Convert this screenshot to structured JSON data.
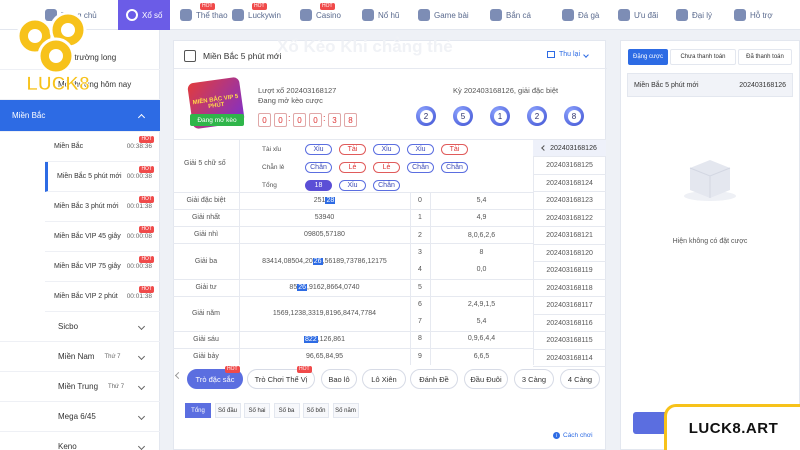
{
  "nav": {
    "items": [
      {
        "label": "Trang chủ",
        "icon": "home-icon",
        "hot": false
      },
      {
        "label": "Xổ số",
        "icon": "lottery-icon",
        "hot": false,
        "active": true
      },
      {
        "label": "Thể thao",
        "icon": "sports-icon",
        "hot": true
      },
      {
        "label": "Luckywin",
        "icon": "luckywin-icon",
        "hot": true
      },
      {
        "label": "Casino",
        "icon": "casino-icon",
        "hot": true
      },
      {
        "label": "Nổ hũ",
        "icon": "slot-icon",
        "hot": false
      },
      {
        "label": "Game bài",
        "icon": "cards-icon",
        "hot": false
      },
      {
        "label": "Bắn cá",
        "icon": "fish-icon",
        "hot": false
      },
      {
        "label": "Đá gà",
        "icon": "rooster-icon",
        "hot": false
      },
      {
        "label": "Ưu đãi",
        "icon": "gift-icon",
        "hot": false
      },
      {
        "label": "Đại lý",
        "icon": "agent-icon",
        "hot": false
      },
      {
        "label": "Hỗ trợ",
        "icon": "support-icon",
        "hot": false
      }
    ],
    "hot_label": "HOT"
  },
  "logo": {
    "text": "LUCK8"
  },
  "sidebar": {
    "top_items": [
      "Các trường long",
      "Mở thưởng hôm nay"
    ],
    "region": "Miền Bắc",
    "sub_items": [
      {
        "label": "Miền Bắc",
        "time": "00:38:36"
      },
      {
        "label": "Miền Bắc 5 phút mới",
        "time": "00:00:38"
      },
      {
        "label": "Miền Bắc 3 phút mới",
        "time": "00:01:38"
      },
      {
        "label": "Miền Bắc VIP 45 giây",
        "time": "00:00:08"
      },
      {
        "label": "Miền Bắc VIP 75 giây",
        "time": "00:00:38"
      },
      {
        "label": "Miền Bắc VIP 2 phút",
        "time": "00:01:38"
      }
    ],
    "groups": [
      {
        "label": "Sicbo",
        "extra": ""
      },
      {
        "label": "Miền Nam",
        "extra": "Thứ 7"
      },
      {
        "label": "Miền Trung",
        "extra": "Thứ 7"
      },
      {
        "label": "Mega 6/45",
        "extra": ""
      },
      {
        "label": "Keno",
        "extra": ""
      }
    ]
  },
  "game": {
    "title": "Miền Bắc 5 phút mới",
    "watermark": "Xổ Kèo Khi chẳng thẻ",
    "collapse": "Thu lại",
    "card_text": "MIỀN BẮC VIP 5 PHÚT",
    "open_badge": "Đang mở kèo",
    "draw_label": "Lượt xổ 202403168127",
    "draw_status": "Đang mở kèo cược",
    "countdown": [
      "0",
      "0",
      "0",
      "0",
      "3",
      "8"
    ],
    "prev_label": "Kỳ 202403168126, giải đặc biệt",
    "balls": [
      "2",
      "5",
      "1",
      "2",
      "8"
    ]
  },
  "results": {
    "g5_label": "Giải 5 chữ số",
    "rows_small": [
      {
        "label": "Tài xỉu",
        "tags": [
          {
            "t": "Xỉu",
            "c": "blue"
          },
          {
            "t": "Tài",
            "c": "red"
          },
          {
            "t": "Xỉu",
            "c": "blue"
          },
          {
            "t": "Xỉu",
            "c": "blue"
          },
          {
            "t": "Tài",
            "c": "red"
          }
        ]
      },
      {
        "label": "Chẵn lẻ",
        "tags": [
          {
            "t": "Chẵn",
            "c": "blue"
          },
          {
            "t": "Lẻ",
            "c": "red"
          },
          {
            "t": "Lẻ",
            "c": "red"
          },
          {
            "t": "Chẵn",
            "c": "blue"
          },
          {
            "t": "Chẵn",
            "c": "blue"
          }
        ]
      },
      {
        "label": "Tổng",
        "tags": [
          {
            "t": "18",
            "c": "fill"
          },
          {
            "t": "Xỉu",
            "c": "blue"
          },
          {
            "t": "Chẵn",
            "c": "blue"
          }
        ]
      }
    ],
    "prizes": [
      {
        "label": "Giải đặc biệt",
        "pre": "251",
        "hl": "28",
        "post": ""
      },
      {
        "label": "Giải nhất",
        "pre": "53940",
        "hl": "",
        "post": ""
      },
      {
        "label": "Giải nhì",
        "pre": "09805,57180",
        "hl": "",
        "post": ""
      },
      {
        "label": "Giải ba",
        "pre": "83414,08504,20",
        "hl": "26",
        "post": ",56189,73786,12175"
      },
      {
        "label": "Giải tư",
        "pre": "85",
        "hl": "26",
        "post": ",9162,8664,0740"
      },
      {
        "label": "Giải năm",
        "pre": "1569,1238,3319,8196,8474,7784",
        "hl": "",
        "post": ""
      },
      {
        "label": "Giải sáu",
        "pre": "",
        "hl": "822",
        "post": ",126,861"
      },
      {
        "label": "Giải bảy",
        "pre": "96,65,84,95",
        "hl": "",
        "post": ""
      }
    ],
    "heads": [
      {
        "d": "0",
        "v": "5,4"
      },
      {
        "d": "1",
        "v": "4,9"
      },
      {
        "d": "2",
        "v": "8,0,6,2,6"
      },
      {
        "d": "3",
        "v": "8"
      },
      {
        "d": "4",
        "v": "0,0"
      },
      {
        "d": "5",
        "v": ""
      },
      {
        "d": "6",
        "v": "2,4,9,1,5"
      },
      {
        "d": "7",
        "v": "5,4"
      },
      {
        "d": "8",
        "v": "0,9,6,4,4"
      },
      {
        "d": "9",
        "v": "6,6,5"
      }
    ],
    "periods": [
      "202403168126",
      "202403168125",
      "202403168124",
      "202403168123",
      "202403168122",
      "202403168121",
      "202403168120",
      "202403168119",
      "202403168118",
      "202403168117",
      "202403168116",
      "202403168115",
      "202403168114"
    ]
  },
  "play_tabs": [
    "Trò đặc sắc",
    "Trò Chơi Thể Vị",
    "Bao lô",
    "Lô Xiên",
    "Đánh Đề",
    "Đầu Đuôi",
    "3 Càng",
    "4 Càng"
  ],
  "sub_tabs": [
    "Tổng",
    "Số đầu",
    "Số hai",
    "Số ba",
    "Số bốn",
    "Số năm"
  ],
  "help": "Cách chơi",
  "right": {
    "tabs": [
      "Đặng cược",
      "Chưa thanh toán",
      "Đã thanh toán"
    ],
    "game": "Miền Bắc 5 phút mới",
    "period": "202403168126",
    "empty": "Hiện không có đặt cược"
  },
  "brand": "LUCK8.ART"
}
